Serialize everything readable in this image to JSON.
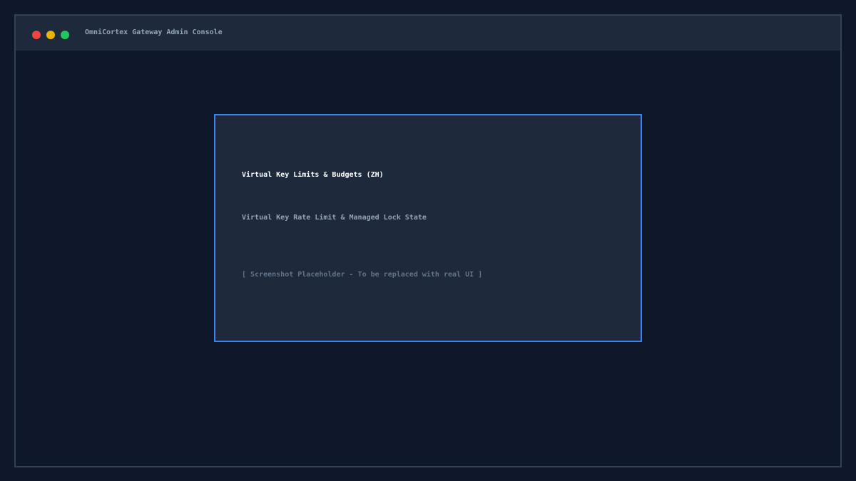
{
  "window": {
    "title": "OmniCortex Gateway Admin Console",
    "controls": {
      "close_color": "#ef4444",
      "minimize_color": "#eab308",
      "maximize_color": "#22c55e"
    }
  },
  "card": {
    "title": "Virtual Key Limits & Budgets (ZH)",
    "subtitle": "Virtual Key Rate Limit & Managed Lock State",
    "placeholder": "[ Screenshot Placeholder - To be replaced with real UI ]"
  },
  "colors": {
    "background": "#0f172a",
    "panel": "#1e293b",
    "accent": "#3b82f6"
  }
}
